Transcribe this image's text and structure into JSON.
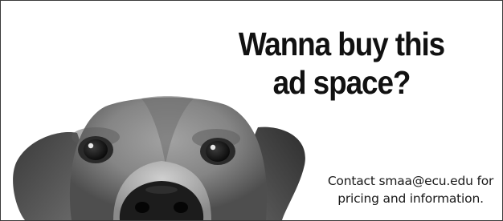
{
  "ad": {
    "headline_line1": "Wanna buy this",
    "headline_line2": "ad space?",
    "contact_line1": "Contact smaa@ecu.edu for",
    "contact_line2": "pricing and information."
  },
  "image": {
    "subject": "dog peeking from bottom edge",
    "style": "grayscale"
  },
  "colors": {
    "background": "#ffffff",
    "text": "#111111",
    "border": "#3a3a3a"
  }
}
